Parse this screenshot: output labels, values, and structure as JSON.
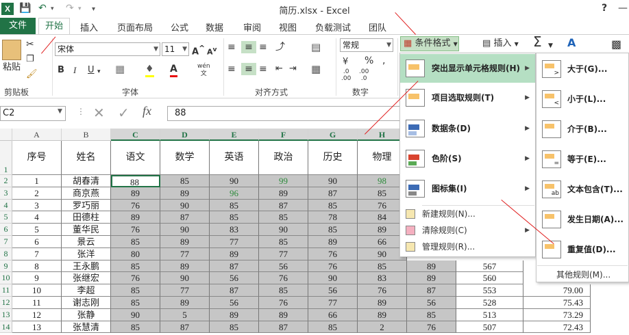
{
  "window": {
    "title": "简历.xlsx - Excel",
    "help": "?",
    "minimize": "—"
  },
  "tabs": [
    "文件",
    "开始",
    "插入",
    "页面布局",
    "公式",
    "数据",
    "审阅",
    "视图",
    "负载测试",
    "团队"
  ],
  "ribbon": {
    "paste_label": "粘贴",
    "font_name": "宋体",
    "font_size": "11",
    "wen_label": "wén",
    "number_format": "常规",
    "cond_format": "条件格式",
    "insert": "插入",
    "groups": {
      "clipboard": "剪贴板",
      "font": "字体",
      "alignment": "对齐方式",
      "number": "数字"
    }
  },
  "formula_bar": {
    "name_box": "C2",
    "content": "88"
  },
  "columns": [
    "A",
    "B",
    "C",
    "D",
    "E",
    "F",
    "G",
    "H"
  ],
  "headers": [
    "序号",
    "姓名",
    "语文",
    "数学",
    "英语",
    "政治",
    "历史",
    "物理"
  ],
  "rows": [
    {
      "num": "2",
      "cells": [
        "1",
        "胡春清",
        "88",
        "85",
        "90",
        "99",
        "90",
        "98"
      ]
    },
    {
      "num": "3",
      "cells": [
        "2",
        "商京燕",
        "89",
        "89",
        "96",
        "89",
        "87",
        "85"
      ]
    },
    {
      "num": "4",
      "cells": [
        "3",
        "罗巧丽",
        "76",
        "90",
        "85",
        "87",
        "85",
        "76"
      ]
    },
    {
      "num": "5",
      "cells": [
        "4",
        "田德柱",
        "89",
        "87",
        "85",
        "85",
        "78",
        "84"
      ]
    },
    {
      "num": "6",
      "cells": [
        "5",
        "董华民",
        "76",
        "90",
        "83",
        "90",
        "85",
        "89"
      ]
    },
    {
      "num": "7",
      "cells": [
        "6",
        "景云",
        "85",
        "89",
        "77",
        "85",
        "89",
        "66"
      ]
    },
    {
      "num": "8",
      "cells": [
        "7",
        "张洋",
        "80",
        "77",
        "89",
        "77",
        "76",
        "90"
      ]
    },
    {
      "num": "9",
      "cells": [
        "8",
        "王永鹏",
        "85",
        "89",
        "87",
        "56",
        "76",
        "85",
        "89",
        "567"
      ]
    },
    {
      "num": "10",
      "cells": [
        "9",
        "张继宏",
        "76",
        "90",
        "56",
        "76",
        "90",
        "83",
        "89",
        "560"
      ]
    },
    {
      "num": "11",
      "cells": [
        "10",
        "李超",
        "85",
        "77",
        "87",
        "85",
        "56",
        "76",
        "87",
        "553",
        "79.00"
      ]
    },
    {
      "num": "12",
      "cells": [
        "11",
        "谢志刚",
        "85",
        "89",
        "56",
        "76",
        "77",
        "89",
        "56",
        "528",
        "75.43"
      ]
    },
    {
      "num": "13",
      "cells": [
        "12",
        "张静",
        "90",
        "5",
        "89",
        "89",
        "66",
        "89",
        "85",
        "513",
        "73.29"
      ]
    },
    {
      "num": "14",
      "cells": [
        "13",
        "张慧清",
        "85",
        "87",
        "85",
        "87",
        "85",
        "2",
        "76",
        "507",
        "72.43"
      ]
    }
  ],
  "menu": {
    "items": [
      {
        "label": "突出显示单元格规则(H)",
        "icon": "highlight-rules-icon"
      },
      {
        "label": "项目选取规则(T)",
        "icon": "top-bottom-rules-icon"
      },
      {
        "label": "数据条(D)",
        "icon": "data-bars-icon"
      },
      {
        "label": "色阶(S)",
        "icon": "color-scales-icon"
      },
      {
        "label": "图标集(I)",
        "icon": "icon-sets-icon"
      }
    ],
    "small_items": [
      {
        "label": "新建规则(N)...",
        "icon": "new-rule-icon"
      },
      {
        "label": "清除规则(C)",
        "icon": "clear-rules-icon"
      },
      {
        "label": "管理规则(R)...",
        "icon": "manage-rules-icon"
      }
    ]
  },
  "submenu": {
    "items": [
      {
        "label": "大于(G)...",
        "sym": ">"
      },
      {
        "label": "小于(L)...",
        "sym": "<"
      },
      {
        "label": "介于(B)...",
        "sym": ""
      },
      {
        "label": "等于(E)...",
        "sym": "="
      },
      {
        "label": "文本包含(T)...",
        "sym": "ab"
      },
      {
        "label": "发生日期(A)...",
        "sym": ""
      },
      {
        "label": "重复值(D)...",
        "sym": ""
      }
    ],
    "more": "其他规则(M)..."
  },
  "colors": {
    "accent": "#217346",
    "highlight": "#b5dfc3",
    "gray_cell": "#c6c6c6",
    "green_text": "#2e8b3c",
    "annotation": "#e02020"
  }
}
